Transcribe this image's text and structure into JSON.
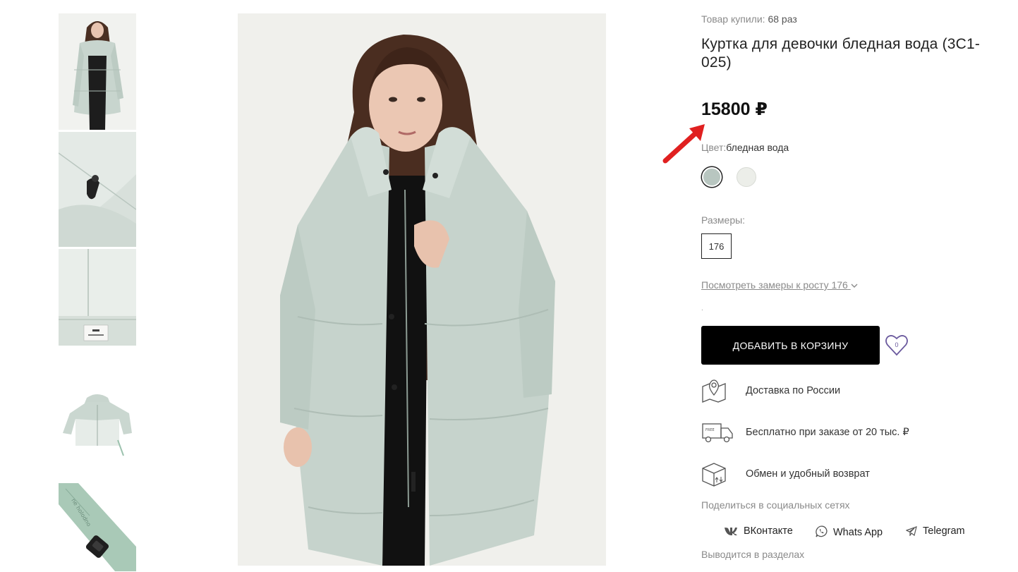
{
  "product": {
    "bought_label": "Товар купили:",
    "bought_count": "68 раз",
    "title": "Куртка для девочки бледная вода (3С1-025)",
    "price": "15800 ₽",
    "color_label": "Цвет:",
    "color_value": "бледная вода",
    "swatches": [
      "#b8c6c0",
      "#eceee9"
    ],
    "sizes_label": "Размеры:",
    "sizes": [
      "176"
    ],
    "measure_link": "Посмотреть замеры к росту 176",
    "dot": ".",
    "add_to_cart": "ДОБАВИТЬ В КОРЗИНУ",
    "favorites_count": "0"
  },
  "features": [
    {
      "icon": "map-pin-icon",
      "text": "Доставка по России"
    },
    {
      "icon": "delivery-truck-icon",
      "text": "Бесплатно при заказе от 20 тыс. ₽"
    },
    {
      "icon": "box-return-icon",
      "text": "Обмен и удобный возврат"
    }
  ],
  "share": {
    "label": "Поделиться в социальных сетях",
    "items": [
      {
        "icon": "vk-icon",
        "label": "ВКонтакте"
      },
      {
        "icon": "whatsapp-icon",
        "label": "Whats App"
      },
      {
        "icon": "telegram-icon",
        "label": "Telegram"
      }
    ]
  },
  "sections_label": "Выводится в разделах",
  "colors": {
    "accent": "#000000",
    "heart": "#6b5a9e",
    "arrow": "#e02020",
    "jacket": "#c6d3cc"
  }
}
